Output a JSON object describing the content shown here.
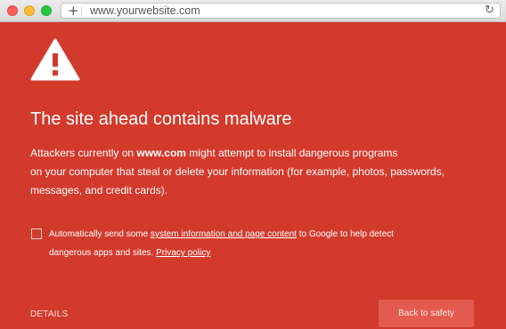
{
  "browser": {
    "url": "www.yourwebsite.com",
    "new_tab_icon": "plus-icon",
    "reload_icon": "reload-icon",
    "window_controls": [
      "close-icon",
      "minimize-icon",
      "zoom-icon"
    ]
  },
  "warning": {
    "icon": "warning-triangle-icon",
    "title": "The site ahead contains malware",
    "desc_prefix": "Attackers currently on ",
    "desc_site": "www.com",
    "desc_line1_rest": " might attempt to install dangerous programs",
    "desc_line2": "on your computer that steal or delete your information (for example, photos, passwords,",
    "desc_line3": "messages, and credit cards)."
  },
  "consent": {
    "checked": false,
    "prefix": "Automatically send some ",
    "link1": "system information and page content",
    "middle": " to Google to help detect",
    "line2": "dangerous apps and sites. ",
    "link2": "Privacy policy"
  },
  "footer": {
    "details_label": "DETAILS",
    "back_label": "Back to safety"
  },
  "colors": {
    "background": "#d23a2c",
    "button": "#e25b4e",
    "text": "#ffffff"
  }
}
